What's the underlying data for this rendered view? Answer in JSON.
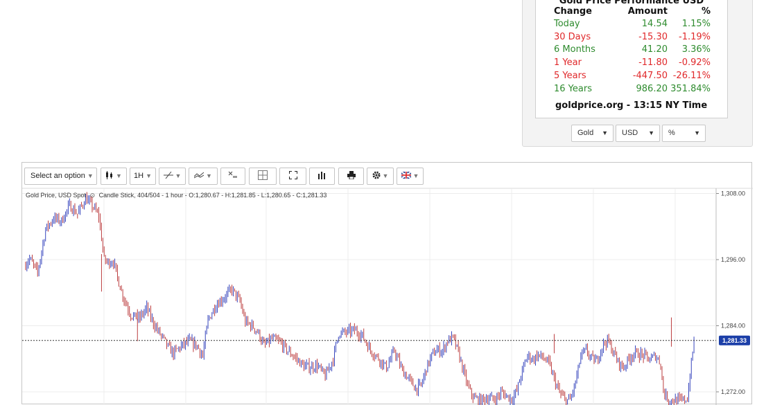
{
  "performance": {
    "title": "Gold Price Performance USD",
    "headers": [
      "Change",
      "Amount",
      "%"
    ],
    "rows": [
      {
        "change": "Today",
        "amount": "14.54",
        "pct": "1.15%",
        "trend": "up"
      },
      {
        "change": "30 Days",
        "amount": "-15.30",
        "pct": "-1.19%",
        "trend": "down"
      },
      {
        "change": "6 Months",
        "amount": "41.20",
        "pct": "3.36%",
        "trend": "up"
      },
      {
        "change": "1 Year",
        "amount": "-11.80",
        "pct": "-0.92%",
        "trend": "down"
      },
      {
        "change": "5 Years",
        "amount": "-447.50",
        "pct": "-26.11%",
        "trend": "down"
      },
      {
        "change": "16 Years",
        "amount": "986.20",
        "pct": "351.84%",
        "trend": "up"
      }
    ],
    "footer": "goldprice.org - 13:15 NY Time",
    "selects": [
      {
        "value": "Gold"
      },
      {
        "value": "USD"
      },
      {
        "value": "%"
      }
    ],
    "colors": {
      "up": "#2e8b2e",
      "down": "#e0282a"
    }
  },
  "toolbar": {
    "select_placeholder": "Select an option",
    "interval": "1H",
    "icons": [
      "candle-type-icon",
      "trendline-icon",
      "indicator-icon",
      "clear-all-icon",
      "crosshair-icon",
      "fullscreen-icon",
      "volume-icon",
      "print-icon",
      "settings-icon",
      "language-flag-icon"
    ]
  },
  "chart_info": {
    "symbol": "Gold Price, USD Spot",
    "description": "Candle Stick, 404/504 - 1 hour - O:1,280.67 - H:1,281.85 - L:1,280.65 - C:1,281.33"
  },
  "chart_data": {
    "type": "candlestick",
    "y_ticks": [
      "1,308.00",
      "1,296.00",
      "1,284.00",
      "1,272.00"
    ],
    "y_tick_values": [
      1308,
      1296,
      1284,
      1272
    ],
    "ylim": [
      1270.5,
      1309.5
    ],
    "last_price": 1281.33,
    "last_price_label": "1,281.33",
    "grid": true,
    "colors": {
      "up": "#1f2fb5",
      "down": "#b5282a",
      "price_tag": "#1c3fa8"
    },
    "close_path": [
      [
        0,
        1294.8
      ],
      [
        4,
        1296.2
      ],
      [
        10,
        1293.6
      ],
      [
        16,
        1301.5
      ],
      [
        22,
        1303.5
      ],
      [
        28,
        1303.0
      ],
      [
        34,
        1305.8
      ],
      [
        40,
        1304.3
      ],
      [
        46,
        1307.1
      ],
      [
        52,
        1305.5
      ],
      [
        56,
        1303.9
      ],
      [
        60,
        1296.0
      ],
      [
        63,
        1295.5
      ],
      [
        67,
        1295.7
      ],
      [
        70,
        1292.7
      ],
      [
        74,
        1289.5
      ],
      [
        80,
        1286.0
      ],
      [
        86,
        1285.2
      ],
      [
        92,
        1287.2
      ],
      [
        96,
        1285.0
      ],
      [
        100,
        1283.2
      ],
      [
        104,
        1281.8
      ],
      [
        108,
        1280.1
      ],
      [
        112,
        1279.0
      ],
      [
        118,
        1280.3
      ],
      [
        124,
        1281.2
      ],
      [
        130,
        1280.3
      ],
      [
        134,
        1278.5
      ],
      [
        138,
        1285.0
      ],
      [
        144,
        1287.8
      ],
      [
        150,
        1289.1
      ],
      [
        156,
        1290.6
      ],
      [
        162,
        1288.4
      ],
      [
        166,
        1284.7
      ],
      [
        172,
        1283.8
      ],
      [
        176,
        1282.6
      ],
      [
        180,
        1280.4
      ],
      [
        186,
        1281.6
      ],
      [
        192,
        1281.0
      ],
      [
        198,
        1279.4
      ],
      [
        204,
        1278.1
      ],
      [
        210,
        1276.6
      ],
      [
        216,
        1276.5
      ],
      [
        220,
        1276.8
      ],
      [
        226,
        1274.8
      ],
      [
        232,
        1278.0
      ],
      [
        236,
        1282.6
      ],
      [
        242,
        1282.8
      ],
      [
        248,
        1283.2
      ],
      [
        254,
        1282.2
      ],
      [
        260,
        1279.5
      ],
      [
        266,
        1278.1
      ],
      [
        272,
        1276.4
      ],
      [
        278,
        1279.5
      ],
      [
        284,
        1275.8
      ],
      [
        288,
        1274.6
      ],
      [
        294,
        1272.6
      ],
      [
        298,
        1273.1
      ],
      [
        302,
        1276.3
      ],
      [
        306,
        1278.6
      ],
      [
        310,
        1279.6
      ],
      [
        314,
        1279.4
      ],
      [
        318,
        1281.3
      ],
      [
        322,
        1281.8
      ],
      [
        326,
        1279.2
      ],
      [
        330,
        1275.6
      ],
      [
        334,
        1272.4
      ],
      [
        338,
        1270.8
      ],
      [
        342,
        1270.5
      ],
      [
        348,
        1270.9
      ],
      [
        354,
        1270.6
      ],
      [
        358,
        1271.9
      ],
      [
        362,
        1271.3
      ],
      [
        366,
        1270.7
      ],
      [
        370,
        1272.2
      ],
      [
        374,
        1275.8
      ],
      [
        378,
        1278.6
      ],
      [
        382,
        1277.9
      ],
      [
        386,
        1278.7
      ],
      [
        390,
        1278.1
      ],
      [
        394,
        1277.2
      ],
      [
        398,
        1274.3
      ],
      [
        402,
        1271.8
      ],
      [
        406,
        1270.6
      ],
      [
        410,
        1270.5
      ],
      [
        414,
        1273.7
      ],
      [
        418,
        1278.5
      ],
      [
        422,
        1279.5
      ],
      [
        426,
        1278.0
      ],
      [
        430,
        1277.6
      ],
      [
        434,
        1280.3
      ],
      [
        438,
        1281.4
      ],
      [
        442,
        1279.4
      ],
      [
        446,
        1277.4
      ],
      [
        450,
        1276.4
      ],
      [
        454,
        1278.0
      ],
      [
        458,
        1279.0
      ],
      [
        462,
        1278.8
      ],
      [
        466,
        1278.5
      ],
      [
        470,
        1277.8
      ],
      [
        474,
        1278.6
      ],
      [
        478,
        1277.1
      ],
      [
        480,
        1272.0
      ],
      [
        484,
        1270.5
      ],
      [
        490,
        1270.5
      ],
      [
        494,
        1270.4
      ],
      [
        498,
        1270.8
      ],
      [
        500,
        1275.0
      ],
      [
        503,
        1281.33
      ]
    ]
  }
}
